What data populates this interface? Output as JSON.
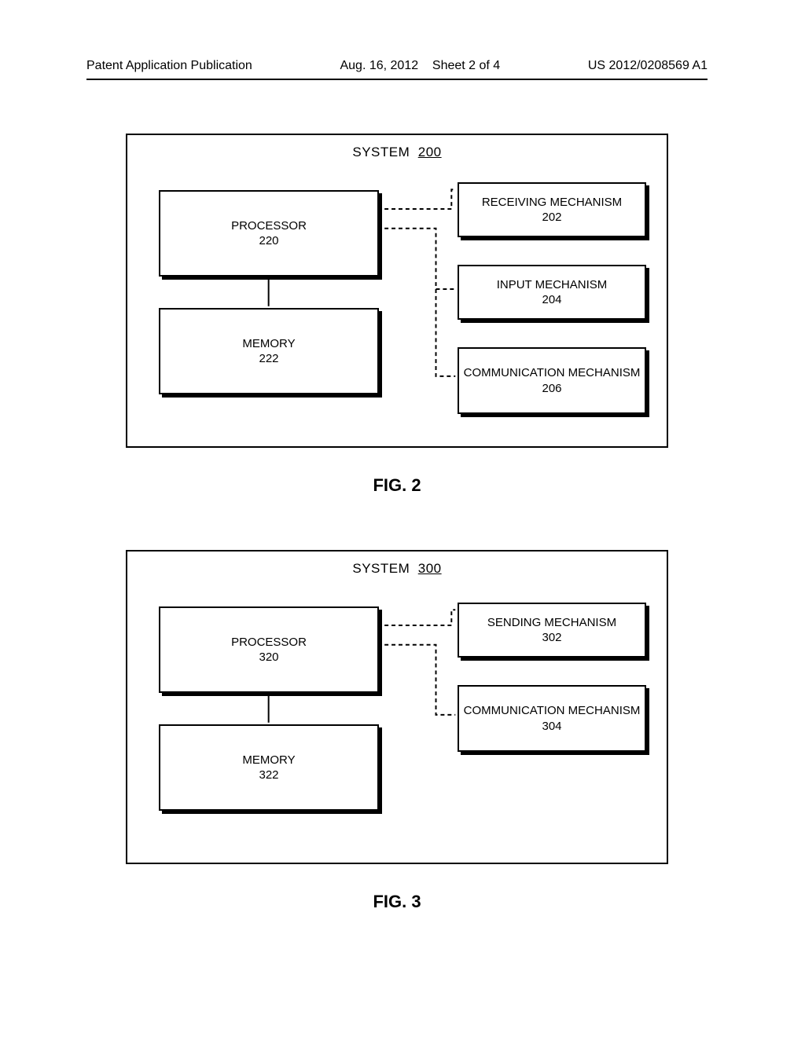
{
  "header": {
    "left": "Patent Application Publication",
    "mid_prefix": "Aug. 16, 2012",
    "mid_sheet": "Sheet 2 of 4",
    "right": "US 2012/0208569 A1"
  },
  "fig2": {
    "caption": "FIG. 2",
    "system_label": "SYSTEM",
    "system_num": "200",
    "processor": {
      "label": "PROCESSOR",
      "num": "220"
    },
    "memory": {
      "label": "MEMORY",
      "num": "222"
    },
    "recv": {
      "label": "RECEIVING MECHANISM",
      "num": "202"
    },
    "input": {
      "label": "INPUT MECHANISM",
      "num": "204"
    },
    "comm": {
      "label": "COMMUNICATION MECHANISM",
      "num": "206"
    }
  },
  "fig3": {
    "caption": "FIG. 3",
    "system_label": "SYSTEM",
    "system_num": "300",
    "processor": {
      "label": "PROCESSOR",
      "num": "320"
    },
    "memory": {
      "label": "MEMORY",
      "num": "322"
    },
    "send": {
      "label": "SENDING MECHANISM",
      "num": "302"
    },
    "comm": {
      "label": "COMMUNICATION MECHANISM",
      "num": "304"
    }
  }
}
